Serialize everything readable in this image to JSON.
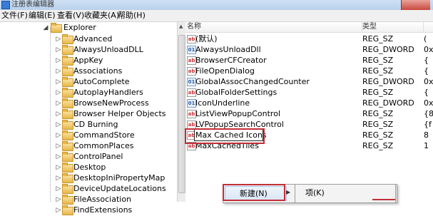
{
  "window": {
    "title": "注册表编辑器"
  },
  "menu": [
    "文件(F)",
    "编辑(E)",
    "查看(V)",
    "收藏夹(A)",
    "帮助(H)"
  ],
  "tree": {
    "parent": "Explorer",
    "children": [
      "Advanced",
      "AlwaysUnloadDLL",
      "AppKey",
      "Associations",
      "AutoComplete",
      "AutoplayHandlers",
      "BrowseNewProcess",
      "Browser Helper Objects",
      "CD Burning",
      "CommandStore",
      "CommonPlaces",
      "ControlPanel",
      "Desktop",
      "DesktopIniPropertyMap",
      "DeviceUpdateLocations",
      "FileAssociation",
      "FindExtensions"
    ]
  },
  "columns": {
    "name": "名称",
    "type": "类型"
  },
  "values": [
    {
      "icon": "ab",
      "name": "(默认)",
      "type": "REG_SZ",
      "data": "("
    },
    {
      "icon": "dw",
      "name": "AlwaysUnloadDll",
      "type": "REG_DWORD",
      "data": "0x"
    },
    {
      "icon": "ab",
      "name": "BrowserCFCreator",
      "type": "REG_SZ",
      "data": "{"
    },
    {
      "icon": "ab",
      "name": "FileOpenDialog",
      "type": "REG_SZ",
      "data": "{"
    },
    {
      "icon": "dw",
      "name": "GlobalAssocChangedCounter",
      "type": "REG_DWORD",
      "data": "0x"
    },
    {
      "icon": "ab",
      "name": "GlobalFolderSettings",
      "type": "REG_SZ",
      "data": "{"
    },
    {
      "icon": "dw",
      "name": "IconUnderline",
      "type": "REG_DWORD",
      "data": "0x"
    },
    {
      "icon": "ab",
      "name": "ListViewPopupControl",
      "type": "REG_SZ",
      "data": "{8"
    },
    {
      "icon": "ab",
      "name": "LVPopupSearchControl",
      "type": "REG_SZ",
      "data": "{f"
    },
    {
      "icon": "ab",
      "name": "Max Cached Icons",
      "type": "REG_SZ",
      "data": "8"
    },
    {
      "icon": "ab",
      "name": "MaxCachedTiles",
      "type": "REG_SZ",
      "data": "1"
    }
  ],
  "context_menu": {
    "new_label": "新建(N)",
    "submenu_first": "项(K)"
  }
}
